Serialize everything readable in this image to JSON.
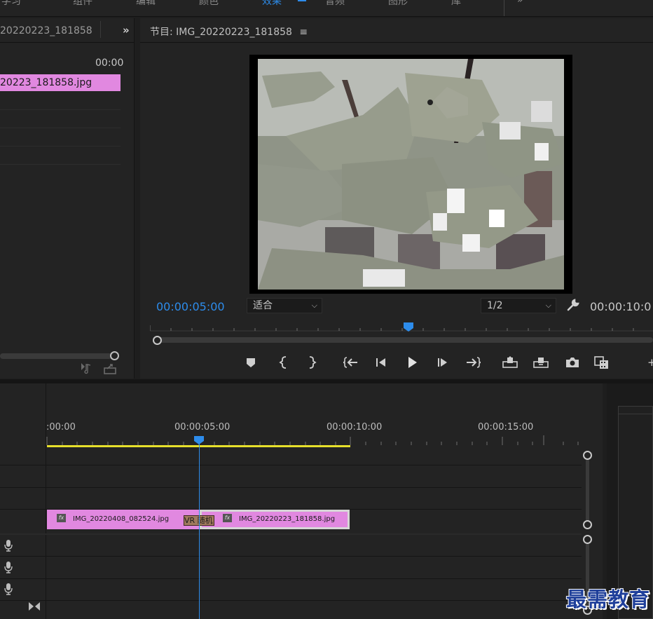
{
  "workspace": {
    "tabs": [
      {
        "label": "学习",
        "active": false
      },
      {
        "label": "组件",
        "active": false
      },
      {
        "label": "编辑",
        "active": false
      },
      {
        "label": "颜色",
        "active": false
      },
      {
        "label": "效果",
        "active": true
      },
      {
        "label": "音频",
        "active": false
      },
      {
        "label": "图形",
        "active": false
      },
      {
        "label": "库",
        "active": false
      }
    ],
    "more_icon": "chevron-double-right-icon",
    "accent_color": "#2d8ceb"
  },
  "source_panel": {
    "tab_label": "20220223_181858",
    "more_icon": "chevron-double-right-icon",
    "timecode": "00:00",
    "clip_name": "20223_181858.jpg",
    "clip_color": "#e188e0"
  },
  "program_monitor": {
    "title": "节目: IMG_20220223_181858",
    "menu_icon": "hamburger-menu-icon",
    "current_time": "00:00:05:00",
    "zoom": "适合",
    "resolution": "1/2",
    "duration": "00:00:10:0",
    "controls": [
      {
        "name": "add-marker-button",
        "icon": "marker-icon"
      },
      {
        "name": "mark-in-button",
        "icon": "mark-in-icon"
      },
      {
        "name": "mark-out-button",
        "icon": "mark-out-icon"
      },
      {
        "name": "go-to-in-button",
        "icon": "go-to-in-icon"
      },
      {
        "name": "step-back-button",
        "icon": "step-back-icon"
      },
      {
        "name": "play-button",
        "icon": "play-icon"
      },
      {
        "name": "step-forward-button",
        "icon": "step-forward-icon"
      },
      {
        "name": "go-to-out-button",
        "icon": "go-to-out-icon"
      },
      {
        "name": "lift-button",
        "icon": "lift-icon"
      },
      {
        "name": "extract-button",
        "icon": "extract-icon"
      },
      {
        "name": "export-frame-button",
        "icon": "camera-icon"
      },
      {
        "name": "comparison-view-button",
        "icon": "comparison-view-icon"
      }
    ]
  },
  "timeline": {
    "ruler_labels": [
      ":00:00",
      "00:00:05:00",
      "00:00:10:00",
      "00:00:15:00"
    ],
    "clips": [
      {
        "label": "IMG_20220408_082524.jpg",
        "fx": "fx"
      },
      {
        "label": "IMG_20220223_181858.jpg",
        "fx": "fx"
      }
    ],
    "transition_label": "VR 随机",
    "work_area_color": "#e6df2b",
    "playhead_color": "#2d8ceb"
  },
  "watermark": "最需教育"
}
